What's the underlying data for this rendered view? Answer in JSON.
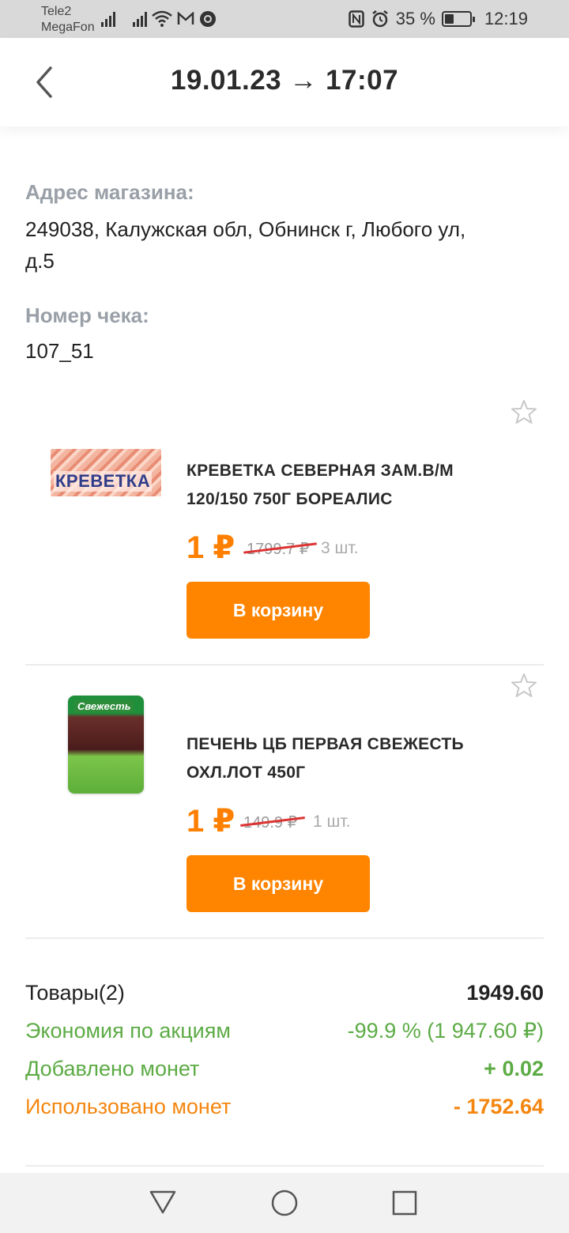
{
  "status_bar": {
    "carrier1": "Tele2",
    "carrier2": "MegaFon",
    "battery_text": "35 %",
    "time": "12:19",
    "battery_level": 0.35
  },
  "header": {
    "title": "19.01.23 → 17:07"
  },
  "store": {
    "address_label": "Адрес магазина:",
    "address_line1": "249038, Калужская обл, Обнинск г, Любого ул,",
    "address_line2": "д.5",
    "receipt_label": "Номер чека:",
    "receipt_number": "107_51"
  },
  "products": [
    {
      "name_line1": "КРЕВЕТКА СЕВЕРНАЯ ЗАМ.В/М",
      "name_line2": "120/150 750Г БОРЕАЛИС",
      "price": "1 ₽",
      "old_price": "1799.7 ₽",
      "qty": "3 шт.",
      "button": "В корзину",
      "image_text": "КРЕВЕТКА"
    },
    {
      "name_line1": "ПЕЧЕНЬ ЦБ ПЕРВАЯ СВЕЖЕСТЬ",
      "name_line2": "ОХЛ.ЛОТ 450Г",
      "price": "1 ₽",
      "old_price": "149.9 ₽",
      "qty": "1 шт.",
      "button": "В корзину",
      "image_text": "Свежесть"
    }
  ],
  "summary": {
    "items_label": "Товары(2)",
    "items_value": "1949.60",
    "discount_label": "Экономия по акциям",
    "discount_value": "-99.9 % (1 947.60 ₽)",
    "coins_added_label": "Добавлено монет",
    "coins_added_value": "+ 0.02",
    "coins_used_label": "Использовано монет",
    "coins_used_value": "- 1752.64"
  },
  "colors": {
    "accent": "#ff8400",
    "green": "#5cab45",
    "orange_text": "#f4860f",
    "label_gray": "#9aa0a8"
  }
}
